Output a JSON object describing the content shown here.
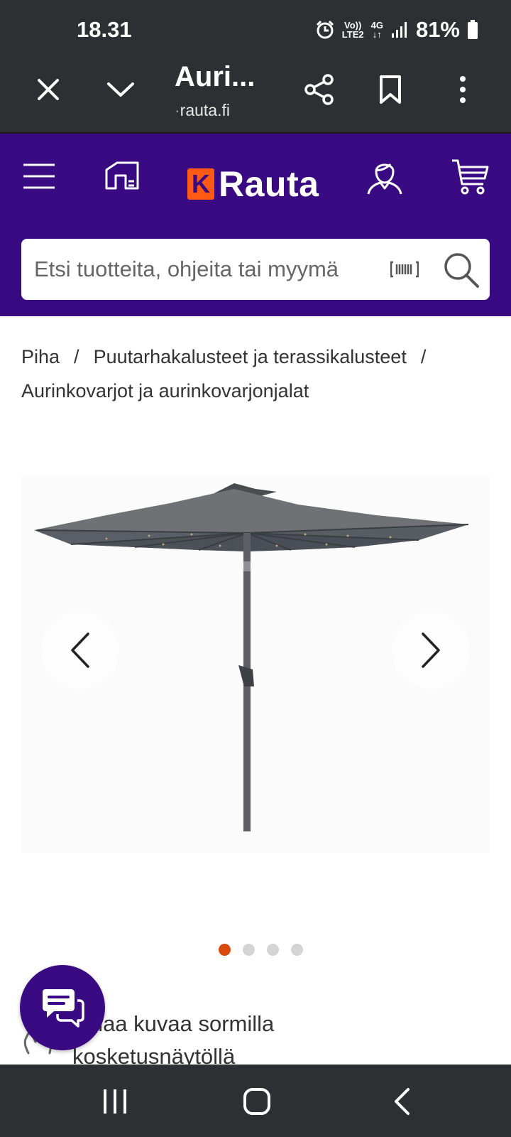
{
  "status_bar": {
    "time": "18.31",
    "volte": "Vo))",
    "lte": "LTE2",
    "network": "4G",
    "battery": "81%"
  },
  "browser": {
    "title": "Auri...",
    "url_prefix": "·",
    "url": "rauta.fi",
    "icons": [
      "close-icon",
      "chevron-down-icon",
      "share-icon",
      "bookmark-icon",
      "more-icon"
    ]
  },
  "header": {
    "logo_k": "K",
    "logo_text": "Rauta",
    "search_placeholder": "Etsi tuotteita, ohjeita tai myymä",
    "background": "#3a0a82",
    "accent": "#ff5a14"
  },
  "breadcrumb": {
    "items": [
      "Piha",
      "Puutarhakalusteet ja terassikalusteet",
      "Aurinkovarjot ja aurinkovarjonjalat"
    ],
    "separator": "/"
  },
  "gallery": {
    "dots_total": 4,
    "active_index": 0,
    "active_color": "#d84b0e"
  },
  "hint": {
    "line1": "omaa kuvaa sormilla",
    "line2": "kosketusnäytöllä"
  }
}
